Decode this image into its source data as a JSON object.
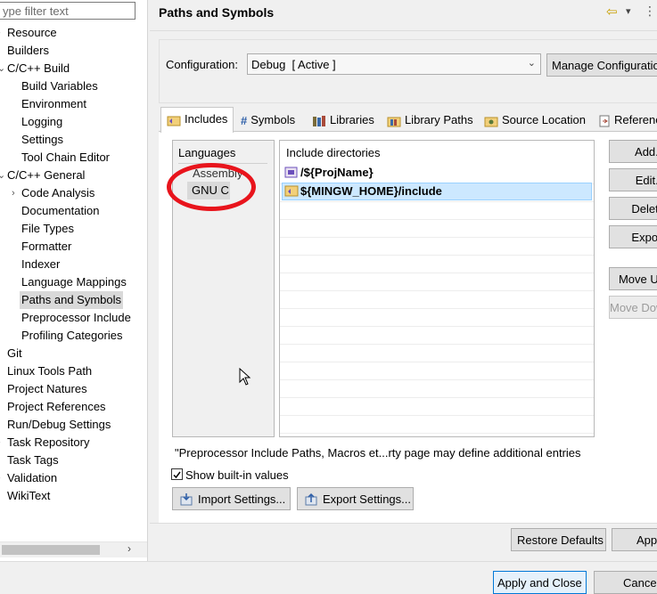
{
  "sidebar": {
    "filter_placeholder": "ype filter text",
    "items": [
      {
        "label": "Resource",
        "twisty": "›"
      },
      {
        "label": "Builders",
        "twisty": ""
      },
      {
        "label": "C/C++ Build",
        "twisty": "⌄"
      },
      {
        "label": "Build Variables",
        "twisty": ""
      },
      {
        "label": "Environment",
        "twisty": ""
      },
      {
        "label": "Logging",
        "twisty": ""
      },
      {
        "label": "Settings",
        "twisty": ""
      },
      {
        "label": "Tool Chain Editor",
        "twisty": ""
      },
      {
        "label": "C/C++ General",
        "twisty": "⌄"
      },
      {
        "label": "Code Analysis",
        "twisty": "›"
      },
      {
        "label": "Documentation",
        "twisty": ""
      },
      {
        "label": "File Types",
        "twisty": ""
      },
      {
        "label": "Formatter",
        "twisty": ""
      },
      {
        "label": "Indexer",
        "twisty": ""
      },
      {
        "label": "Language Mappings",
        "twisty": ""
      },
      {
        "label": "Paths and Symbols",
        "twisty": ""
      },
      {
        "label": "Preprocessor Include",
        "twisty": ""
      },
      {
        "label": "Profiling Categories",
        "twisty": ""
      },
      {
        "label": "Git",
        "twisty": ""
      },
      {
        "label": "Linux Tools Path",
        "twisty": ""
      },
      {
        "label": "Project Natures",
        "twisty": ""
      },
      {
        "label": "Project References",
        "twisty": ""
      },
      {
        "label": "Run/Debug Settings",
        "twisty": ""
      },
      {
        "label": "Task Repository",
        "twisty": "›"
      },
      {
        "label": "Task Tags",
        "twisty": ""
      },
      {
        "label": "Validation",
        "twisty": "›"
      },
      {
        "label": "WikiText",
        "twisty": ""
      }
    ],
    "selected": "Paths and Symbols",
    "scroll_arrow": "›"
  },
  "header": {
    "title": "Paths and Symbols",
    "nav_arrow": "⇦",
    "nav_dropdown": "▾",
    "menu_icon": "⋮"
  },
  "config": {
    "label": "Configuration:",
    "value": "Debug  [ Active ]",
    "manage_label": "Manage Configurations..."
  },
  "tabs": [
    "Includes",
    "Symbols",
    "Libraries",
    "Library Paths",
    "Source Location",
    "References"
  ],
  "active_tab": "Includes",
  "languages": {
    "header": "Languages",
    "items": [
      "Assembly",
      "GNU C"
    ]
  },
  "include_dirs": {
    "header": "Include directories",
    "items": [
      "/${ProjName}",
      "${MINGW_HOME}/include"
    ]
  },
  "side_buttons": [
    "Add...",
    "Edit...",
    "Delete",
    "Export",
    "Move Up",
    "Move Down"
  ],
  "note": "\"Preprocessor Include Paths, Macros et...rty page may define additional entries",
  "show_builtin": {
    "label": "Show built-in values",
    "checked": true
  },
  "import_label": "Import Settings...",
  "export_label": "Export Settings...",
  "restore_label": "Restore Defaults",
  "apply_label": "Apply",
  "apply_close_label": "Apply and Close",
  "cancel_label": "Cancel",
  "colors": {
    "selection": "#cce8ff",
    "annotation": "#e8141c",
    "accent": "#0078d7"
  }
}
